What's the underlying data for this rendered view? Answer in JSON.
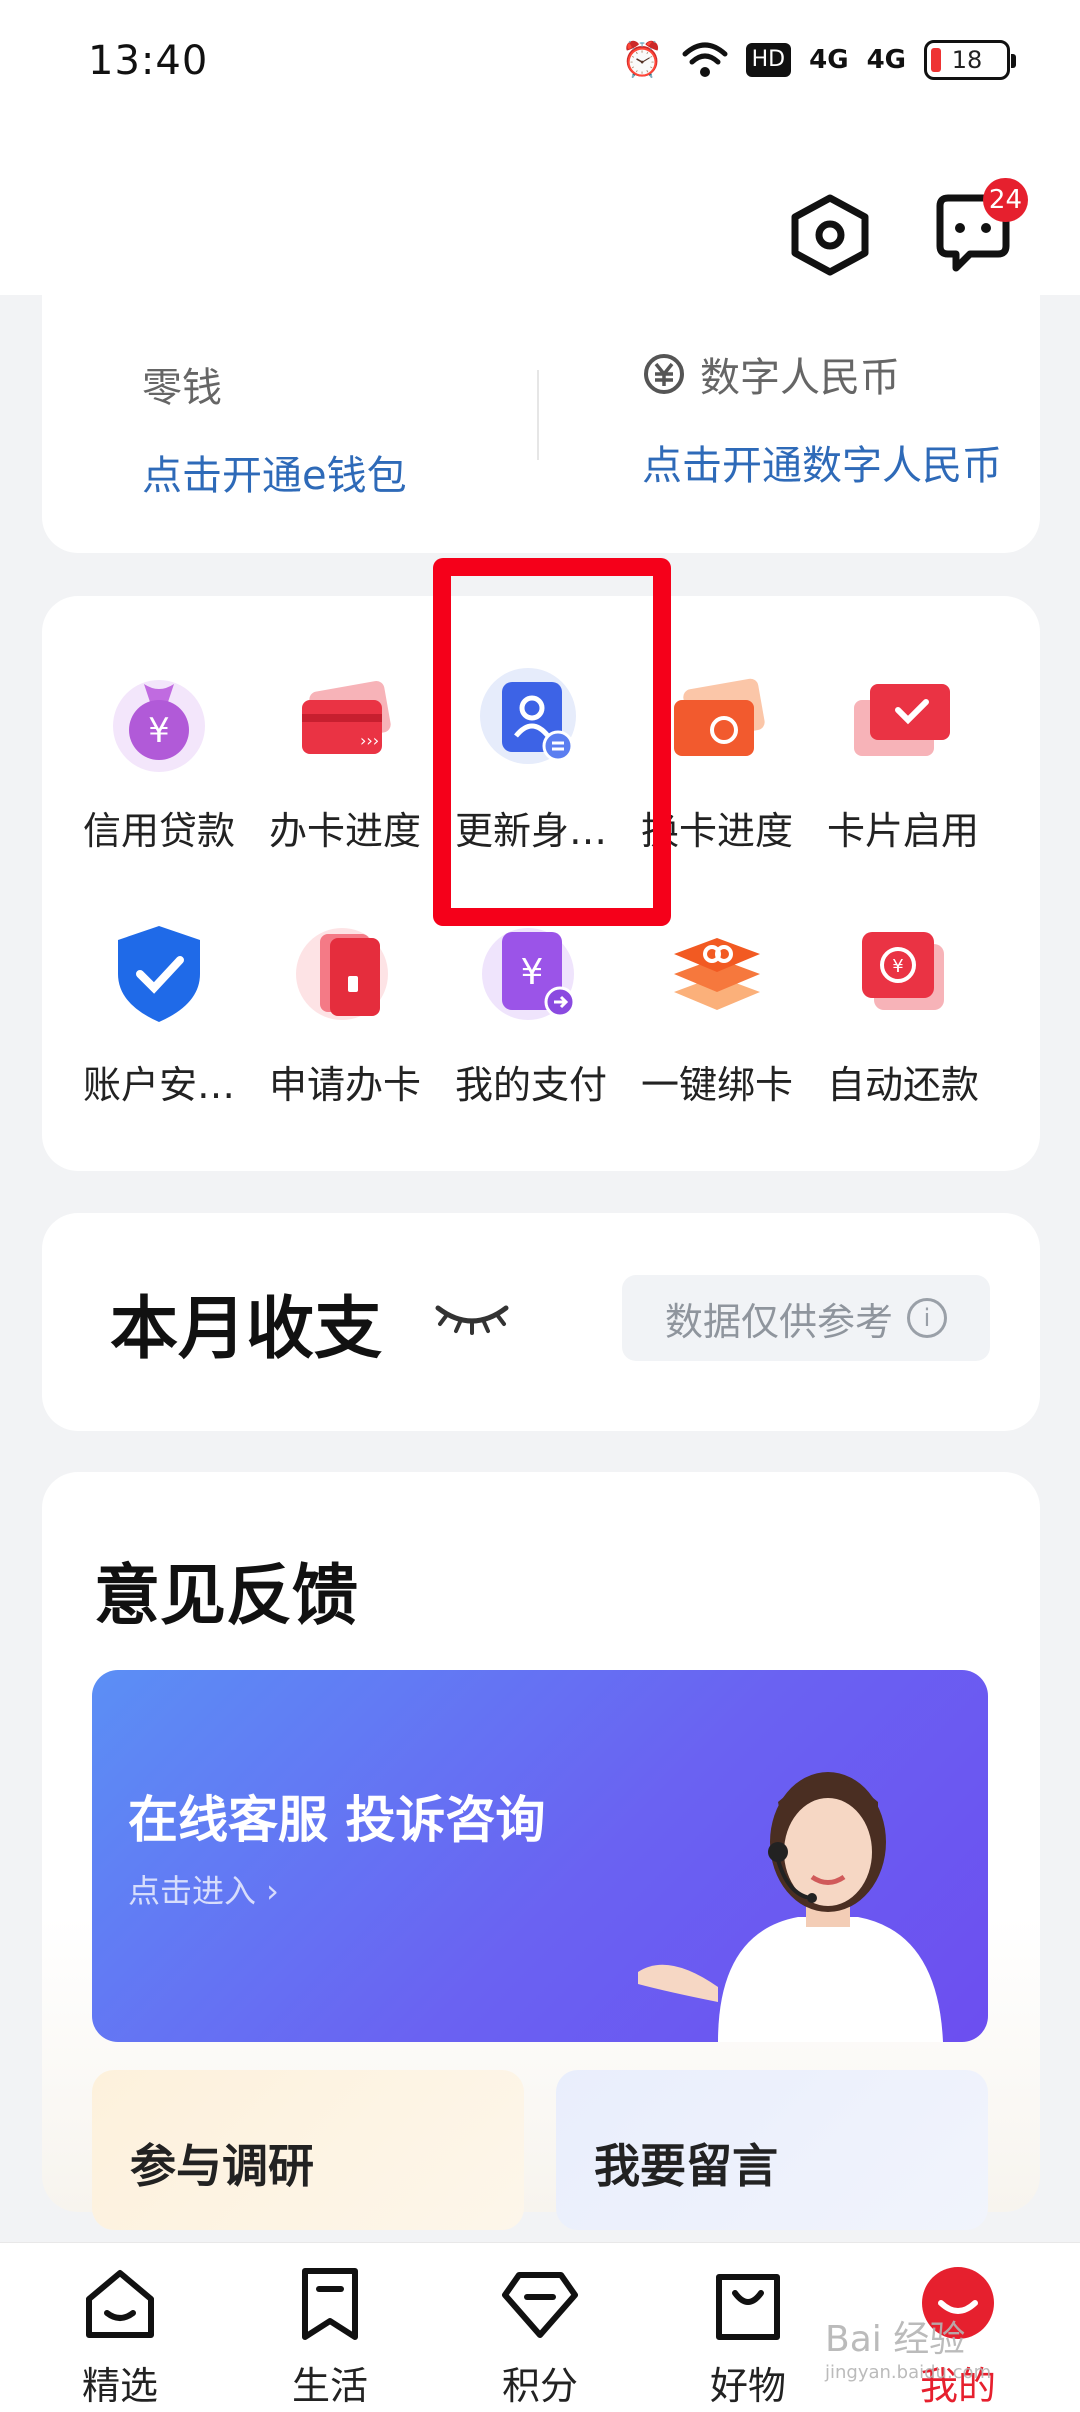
{
  "status": {
    "time": "13:40",
    "hd": "HD",
    "signal1": "4G",
    "signal2": "4G",
    "battery": "18"
  },
  "header": {
    "message_badge": "24"
  },
  "wallet": {
    "change_label": "零钱",
    "change_link": "点击开通e钱包",
    "ecny_label": "数字人民币",
    "ecny_link": "点击开通数字人民币"
  },
  "services": [
    {
      "label": "信用贷款",
      "icon": "money-bag-icon"
    },
    {
      "label": "办卡进度",
      "icon": "card-progress-icon"
    },
    {
      "label": "更新身…",
      "icon": "update-id-icon"
    },
    {
      "label": "换卡进度",
      "icon": "card-exchange-icon"
    },
    {
      "label": "卡片启用",
      "icon": "card-activate-icon"
    },
    {
      "label": "账户安…",
      "icon": "shield-icon"
    },
    {
      "label": "申请办卡",
      "icon": "apply-card-icon"
    },
    {
      "label": "我的支付",
      "icon": "my-payment-icon"
    },
    {
      "label": "一键绑卡",
      "icon": "bind-card-icon"
    },
    {
      "label": "自动还款",
      "icon": "auto-repay-icon"
    }
  ],
  "monthly": {
    "title": "本月收支",
    "note": "数据仅供参考"
  },
  "feedback": {
    "title": "意见反馈",
    "banner_title": "在线客服 投诉咨询",
    "banner_sub": "点击进入 ›",
    "survey": "参与调研",
    "message": "我要留言"
  },
  "tabs": [
    {
      "label": "精选"
    },
    {
      "label": "生活"
    },
    {
      "label": "积分"
    },
    {
      "label": "好物"
    },
    {
      "label": "我的"
    }
  ],
  "watermark": {
    "text": "Bai 经验",
    "sub": "jingyan.baidu.com"
  },
  "colors": {
    "accent": "#e6202e",
    "link": "#2e6ab8",
    "highlight": "#f5001a"
  }
}
